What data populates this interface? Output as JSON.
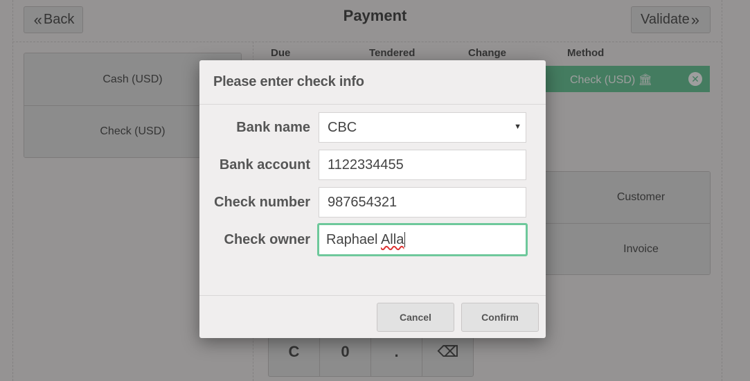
{
  "header": {
    "back_label": "Back",
    "title": "Payment",
    "validate_label": "Validate"
  },
  "payment_methods": [
    {
      "label": "Cash (USD)"
    },
    {
      "label": "Check (USD)"
    }
  ],
  "lines_table": {
    "columns": [
      "Due",
      "Tendered",
      "Change",
      "Method"
    ],
    "selected_line": {
      "method": "Check (USD)",
      "method_icon": "bank-icon"
    }
  },
  "side_buttons": {
    "customer_label": "Customer",
    "invoice_label": "Invoice"
  },
  "numpad": {
    "keys": [
      "C",
      "0",
      ".",
      "⌫"
    ]
  },
  "dialog": {
    "title": "Please enter check info",
    "fields": {
      "bank_name": {
        "label": "Bank name",
        "value": "CBC"
      },
      "bank_account": {
        "label": "Bank account",
        "value": "1122334455"
      },
      "check_number": {
        "label": "Check number",
        "value": "987654321"
      },
      "check_owner": {
        "label": "Check owner",
        "value_prefix": "Raphael ",
        "value_misspelled": "Alla"
      }
    },
    "cancel_label": "Cancel",
    "confirm_label": "Confirm"
  },
  "colors": {
    "accent": "#6ec89b",
    "background": "#f0eeee"
  }
}
